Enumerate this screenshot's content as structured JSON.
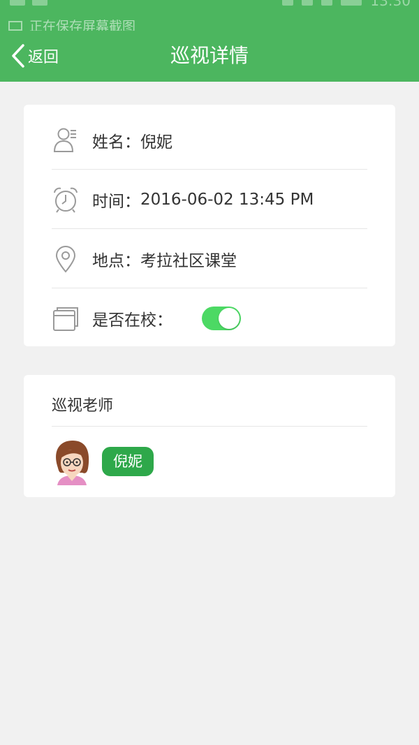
{
  "status_bar": {
    "time": "13:30"
  },
  "notification": {
    "text": "正在保存屏幕截图"
  },
  "nav": {
    "back_label": "返回",
    "title": "巡视详情"
  },
  "info": {
    "name_label": "姓名：",
    "name_value": "倪妮",
    "time_label": "时间：",
    "time_value": "2016-06-02 13:45 PM",
    "place_label": "地点：",
    "place_value": "考拉社区课堂",
    "at_school_label": "是否在校：",
    "at_school_on": true
  },
  "teacher": {
    "section_title": "巡视老师",
    "name": "倪妮"
  },
  "colors": {
    "header": "#4cb65f",
    "toggle_on": "#4cd964",
    "tag": "#2ea84a"
  }
}
